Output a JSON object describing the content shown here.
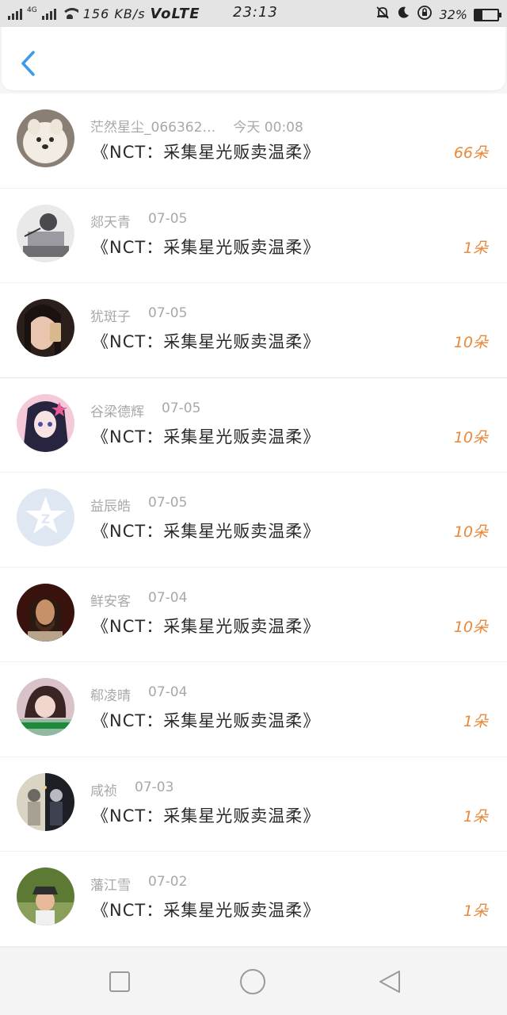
{
  "status_bar": {
    "network_tag": "4G",
    "speed": "156 KB/s",
    "volte": "VoLTE",
    "time": "23:13",
    "battery_percent": "32%",
    "battery_level": 0.32,
    "icons": [
      "mute-icon",
      "moon-icon",
      "lock-rotation-icon",
      "battery-icon"
    ]
  },
  "header": {
    "back_icon": "chevron-left-icon",
    "accent_color": "#3a9bea"
  },
  "gifts": [
    {
      "user": "茫然星尘_066362…",
      "date": "今天 00:08",
      "title": "《NCT：采集星光贩卖温柔》",
      "count": "66朵",
      "avatar": "dog-avatar"
    },
    {
      "user": "郯天青",
      "date": "07-05",
      "title": "《NCT：采集星光贩卖温柔》",
      "count": "1朵",
      "avatar": "sketch-avatar"
    },
    {
      "user": "犹斑子",
      "date": "07-05",
      "title": "《NCT：采集星光贩卖温柔》",
      "count": "10朵",
      "avatar": "girl-phone-avatar"
    },
    {
      "user": "谷梁德辉",
      "date": "07-05",
      "title": "《NCT：采集星光贩卖温柔》",
      "count": "10朵",
      "avatar": "anime-avatar"
    },
    {
      "user": "益辰皓",
      "date": "07-05",
      "title": "《NCT：采集星光贩卖温柔》",
      "count": "10朵",
      "avatar": "default-qq-avatar"
    },
    {
      "user": "鲜安客",
      "date": "07-04",
      "title": "《NCT：采集星光贩卖温柔》",
      "count": "10朵",
      "avatar": "portrait-avatar"
    },
    {
      "user": "郗凌晴",
      "date": "07-04",
      "title": "《NCT：采集星光贩卖温柔》",
      "count": "1朵",
      "avatar": "girl-caption-avatar"
    },
    {
      "user": "咸祯",
      "date": "07-03",
      "title": "《NCT：采集星光贩卖温柔》",
      "count": "1朵",
      "avatar": "couple-avatar"
    },
    {
      "user": "藩江雪",
      "date": "07-02",
      "title": "《NCT：采集星光贩卖温柔》",
      "count": "1朵",
      "avatar": "outdoor-avatar"
    }
  ],
  "nav_bar": {
    "recent_icon": "square-icon",
    "home_icon": "circle-icon",
    "back_icon": "triangle-back-icon"
  },
  "colors": {
    "count": "#e8883a",
    "meta": "#a8a8a8",
    "title": "#2a2a2a",
    "accent": "#3a9bea"
  }
}
